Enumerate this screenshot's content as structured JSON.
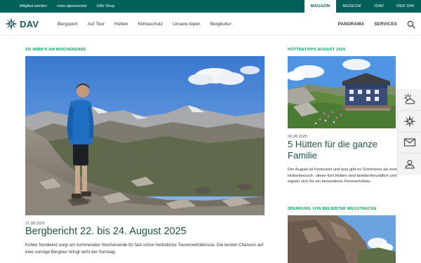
{
  "utility_bar": {
    "left_links": [
      "Mitglied werden",
      "mein.alpenverein",
      "DAV Shop"
    ],
    "right_tabs": [
      {
        "label": "MAGAZIN",
        "active": true
      },
      {
        "label": "MUSEUM",
        "active": false
      },
      {
        "label": "JDAV",
        "active": false
      },
      {
        "label": "DER DAV",
        "active": false
      }
    ]
  },
  "header": {
    "logo_text": "DAV",
    "logo_icon": "edelweiss-icon",
    "nav_items": [
      "Bergsport",
      "Auf Tour",
      "Hütten",
      "Klimaschutz",
      "Unsere Alpen",
      "Bergkultur"
    ],
    "right_items": [
      "PANORAMA",
      "SERVICES"
    ],
    "search_icon": "search-icon"
  },
  "main_article": {
    "eyebrow": "SO WIRD'S AM WOCHENENDE",
    "date": "21.08.2025",
    "title": "Bergbericht 22. bis 24. August 2025",
    "teaser": "Kühler Nordwind sorgt am kommenden Wochenende für fast schon herbstliche Tourenverhältnisse. Die besten Chancen auf eine sonnige Bergtour bringt wohl der Sonntag."
  },
  "side_article_1": {
    "eyebrow": "HÜTTENTIPPS AUGUST 2025",
    "date": "06.08.2025",
    "title": "5 Hütten für die ganze Familie",
    "teaser": "Der August ist Ferienzeit und was gibt es Schöneres als einen Hüttenbesuch - diese fünf Hütten sind familienfreundlich und eignen sich für ein besonderes Ferienerlebnis."
  },
  "side_article_2": {
    "eyebrow": "SPERRUNG VON BELIEBTER WEGSTRECKE"
  },
  "action_rail": {
    "icons": [
      "weather-icon",
      "edelweiss-icon",
      "mail-icon",
      "member-icon"
    ]
  },
  "colors": {
    "brand_dark_green": "#00605a",
    "accent_green": "#00a35c",
    "title_green": "#1e4f4a"
  }
}
